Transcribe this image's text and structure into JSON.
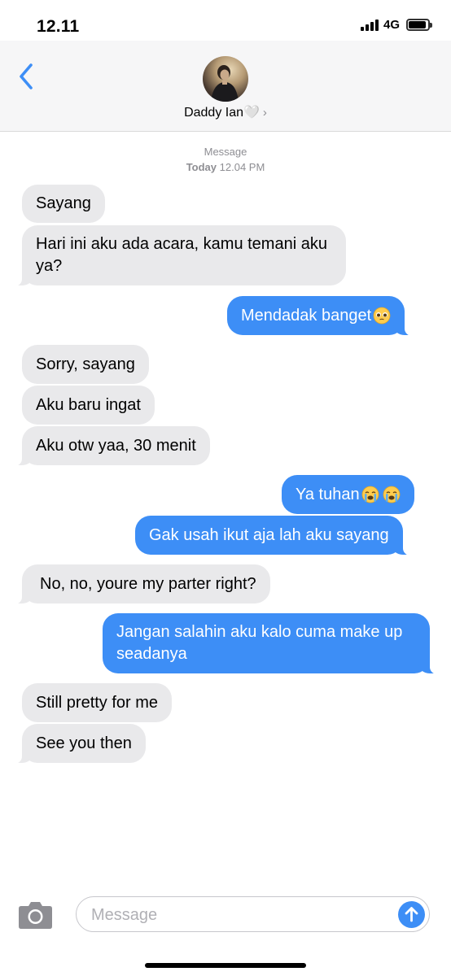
{
  "status_bar": {
    "time": "12.11",
    "network": "4G"
  },
  "header": {
    "contact_name": "Daddy Ian🤍",
    "chevron": "›",
    "back_icon": "chevron-left-icon"
  },
  "thread": {
    "service": "Message",
    "date_label": "Today",
    "time_label": "12.04 PM"
  },
  "messages": [
    {
      "from": "in",
      "text": "Sayang"
    },
    {
      "from": "in",
      "text": "Hari ini aku ada acara, kamu temani aku ya?"
    },
    {
      "from": "out",
      "text": "Mendadak banget",
      "emoji": "pleading-face"
    },
    {
      "from": "in",
      "text": "Sorry, sayang"
    },
    {
      "from": "in",
      "text": "Aku baru ingat"
    },
    {
      "from": "in",
      "text": "Aku otw yaa, 30 menit"
    },
    {
      "from": "out",
      "text": "Ya tuhan",
      "emoji": "crying-face x2"
    },
    {
      "from": "out",
      "text": "Gak usah ikut aja lah aku sayang"
    },
    {
      "from": "in",
      "text": "No, no, youre my parter right?"
    },
    {
      "from": "out",
      "text": "Jangan salahin aku kalo cuma make up seadanya"
    },
    {
      "from": "in",
      "text": "Still pretty for me"
    },
    {
      "from": "in",
      "text": "See you then"
    }
  ],
  "composer": {
    "placeholder": "Message"
  },
  "colors": {
    "incoming": "#e9e9eb",
    "outgoing": "#3d8ef6",
    "accent": "#3d8ef6"
  }
}
